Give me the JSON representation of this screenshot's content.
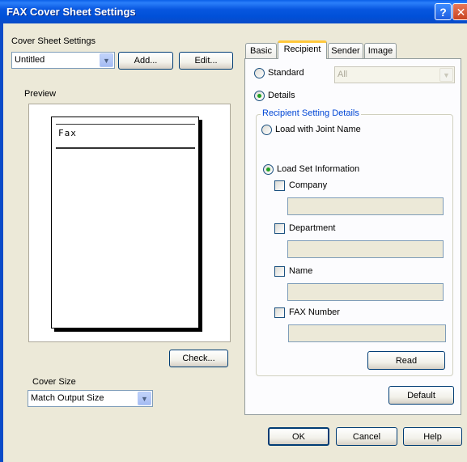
{
  "window": {
    "title": "FAX Cover Sheet Settings",
    "help_glyph": "?",
    "close_glyph": "✕"
  },
  "cover_sheet": {
    "label": "Cover Sheet Settings",
    "selected": "Untitled",
    "add_label": "Add...",
    "edit_label": "Edit..."
  },
  "preview": {
    "label": "Preview",
    "doc_title": "Fax",
    "check_label": "Check..."
  },
  "cover_size": {
    "label": "Cover Size",
    "selected": "Match Output Size"
  },
  "tabs": [
    {
      "label": "Basic"
    },
    {
      "label": "Recipient"
    },
    {
      "label": "Sender"
    },
    {
      "label": "Image"
    }
  ],
  "recipient": {
    "standard_label": "Standard",
    "standard_selected": "All",
    "details_label": "Details",
    "group_label": "Recipient Setting Details",
    "joint_name_label": "Load with Joint Name",
    "load_set_label": "Load Set Information",
    "fields": [
      {
        "label": "Company",
        "value": ""
      },
      {
        "label": "Department",
        "value": ""
      },
      {
        "label": "Name",
        "value": ""
      },
      {
        "label": "FAX Number",
        "value": ""
      }
    ],
    "read_label": "Read",
    "default_label": "Default"
  },
  "footer": {
    "ok_label": "OK",
    "cancel_label": "Cancel",
    "help_label": "Help"
  },
  "colors": {
    "title_bar": "#0050D8",
    "dialog_bg": "#ECE9D8",
    "group_text": "#0046D5",
    "radio_dot": "#21A121",
    "active_tab_accent": "#FFC83C"
  }
}
